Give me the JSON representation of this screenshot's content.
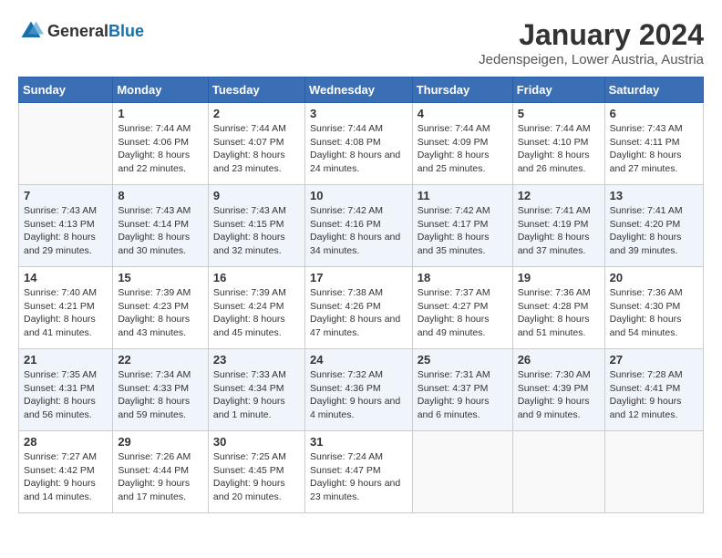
{
  "header": {
    "logo_general": "General",
    "logo_blue": "Blue",
    "month_title": "January 2024",
    "location": "Jedenspeigen, Lower Austria, Austria"
  },
  "days_of_week": [
    "Sunday",
    "Monday",
    "Tuesday",
    "Wednesday",
    "Thursday",
    "Friday",
    "Saturday"
  ],
  "weeks": [
    [
      {
        "day": "",
        "sunrise": "",
        "sunset": "",
        "daylight": ""
      },
      {
        "day": "1",
        "sunrise": "Sunrise: 7:44 AM",
        "sunset": "Sunset: 4:06 PM",
        "daylight": "Daylight: 8 hours and 22 minutes."
      },
      {
        "day": "2",
        "sunrise": "Sunrise: 7:44 AM",
        "sunset": "Sunset: 4:07 PM",
        "daylight": "Daylight: 8 hours and 23 minutes."
      },
      {
        "day": "3",
        "sunrise": "Sunrise: 7:44 AM",
        "sunset": "Sunset: 4:08 PM",
        "daylight": "Daylight: 8 hours and 24 minutes."
      },
      {
        "day": "4",
        "sunrise": "Sunrise: 7:44 AM",
        "sunset": "Sunset: 4:09 PM",
        "daylight": "Daylight: 8 hours and 25 minutes."
      },
      {
        "day": "5",
        "sunrise": "Sunrise: 7:44 AM",
        "sunset": "Sunset: 4:10 PM",
        "daylight": "Daylight: 8 hours and 26 minutes."
      },
      {
        "day": "6",
        "sunrise": "Sunrise: 7:43 AM",
        "sunset": "Sunset: 4:11 PM",
        "daylight": "Daylight: 8 hours and 27 minutes."
      }
    ],
    [
      {
        "day": "7",
        "sunrise": "Sunrise: 7:43 AM",
        "sunset": "Sunset: 4:13 PM",
        "daylight": "Daylight: 8 hours and 29 minutes."
      },
      {
        "day": "8",
        "sunrise": "Sunrise: 7:43 AM",
        "sunset": "Sunset: 4:14 PM",
        "daylight": "Daylight: 8 hours and 30 minutes."
      },
      {
        "day": "9",
        "sunrise": "Sunrise: 7:43 AM",
        "sunset": "Sunset: 4:15 PM",
        "daylight": "Daylight: 8 hours and 32 minutes."
      },
      {
        "day": "10",
        "sunrise": "Sunrise: 7:42 AM",
        "sunset": "Sunset: 4:16 PM",
        "daylight": "Daylight: 8 hours and 34 minutes."
      },
      {
        "day": "11",
        "sunrise": "Sunrise: 7:42 AM",
        "sunset": "Sunset: 4:17 PM",
        "daylight": "Daylight: 8 hours and 35 minutes."
      },
      {
        "day": "12",
        "sunrise": "Sunrise: 7:41 AM",
        "sunset": "Sunset: 4:19 PM",
        "daylight": "Daylight: 8 hours and 37 minutes."
      },
      {
        "day": "13",
        "sunrise": "Sunrise: 7:41 AM",
        "sunset": "Sunset: 4:20 PM",
        "daylight": "Daylight: 8 hours and 39 minutes."
      }
    ],
    [
      {
        "day": "14",
        "sunrise": "Sunrise: 7:40 AM",
        "sunset": "Sunset: 4:21 PM",
        "daylight": "Daylight: 8 hours and 41 minutes."
      },
      {
        "day": "15",
        "sunrise": "Sunrise: 7:39 AM",
        "sunset": "Sunset: 4:23 PM",
        "daylight": "Daylight: 8 hours and 43 minutes."
      },
      {
        "day": "16",
        "sunrise": "Sunrise: 7:39 AM",
        "sunset": "Sunset: 4:24 PM",
        "daylight": "Daylight: 8 hours and 45 minutes."
      },
      {
        "day": "17",
        "sunrise": "Sunrise: 7:38 AM",
        "sunset": "Sunset: 4:26 PM",
        "daylight": "Daylight: 8 hours and 47 minutes."
      },
      {
        "day": "18",
        "sunrise": "Sunrise: 7:37 AM",
        "sunset": "Sunset: 4:27 PM",
        "daylight": "Daylight: 8 hours and 49 minutes."
      },
      {
        "day": "19",
        "sunrise": "Sunrise: 7:36 AM",
        "sunset": "Sunset: 4:28 PM",
        "daylight": "Daylight: 8 hours and 51 minutes."
      },
      {
        "day": "20",
        "sunrise": "Sunrise: 7:36 AM",
        "sunset": "Sunset: 4:30 PM",
        "daylight": "Daylight: 8 hours and 54 minutes."
      }
    ],
    [
      {
        "day": "21",
        "sunrise": "Sunrise: 7:35 AM",
        "sunset": "Sunset: 4:31 PM",
        "daylight": "Daylight: 8 hours and 56 minutes."
      },
      {
        "day": "22",
        "sunrise": "Sunrise: 7:34 AM",
        "sunset": "Sunset: 4:33 PM",
        "daylight": "Daylight: 8 hours and 59 minutes."
      },
      {
        "day": "23",
        "sunrise": "Sunrise: 7:33 AM",
        "sunset": "Sunset: 4:34 PM",
        "daylight": "Daylight: 9 hours and 1 minute."
      },
      {
        "day": "24",
        "sunrise": "Sunrise: 7:32 AM",
        "sunset": "Sunset: 4:36 PM",
        "daylight": "Daylight: 9 hours and 4 minutes."
      },
      {
        "day": "25",
        "sunrise": "Sunrise: 7:31 AM",
        "sunset": "Sunset: 4:37 PM",
        "daylight": "Daylight: 9 hours and 6 minutes."
      },
      {
        "day": "26",
        "sunrise": "Sunrise: 7:30 AM",
        "sunset": "Sunset: 4:39 PM",
        "daylight": "Daylight: 9 hours and 9 minutes."
      },
      {
        "day": "27",
        "sunrise": "Sunrise: 7:28 AM",
        "sunset": "Sunset: 4:41 PM",
        "daylight": "Daylight: 9 hours and 12 minutes."
      }
    ],
    [
      {
        "day": "28",
        "sunrise": "Sunrise: 7:27 AM",
        "sunset": "Sunset: 4:42 PM",
        "daylight": "Daylight: 9 hours and 14 minutes."
      },
      {
        "day": "29",
        "sunrise": "Sunrise: 7:26 AM",
        "sunset": "Sunset: 4:44 PM",
        "daylight": "Daylight: 9 hours and 17 minutes."
      },
      {
        "day": "30",
        "sunrise": "Sunrise: 7:25 AM",
        "sunset": "Sunset: 4:45 PM",
        "daylight": "Daylight: 9 hours and 20 minutes."
      },
      {
        "day": "31",
        "sunrise": "Sunrise: 7:24 AM",
        "sunset": "Sunset: 4:47 PM",
        "daylight": "Daylight: 9 hours and 23 minutes."
      },
      {
        "day": "",
        "sunrise": "",
        "sunset": "",
        "daylight": ""
      },
      {
        "day": "",
        "sunrise": "",
        "sunset": "",
        "daylight": ""
      },
      {
        "day": "",
        "sunrise": "",
        "sunset": "",
        "daylight": ""
      }
    ]
  ]
}
